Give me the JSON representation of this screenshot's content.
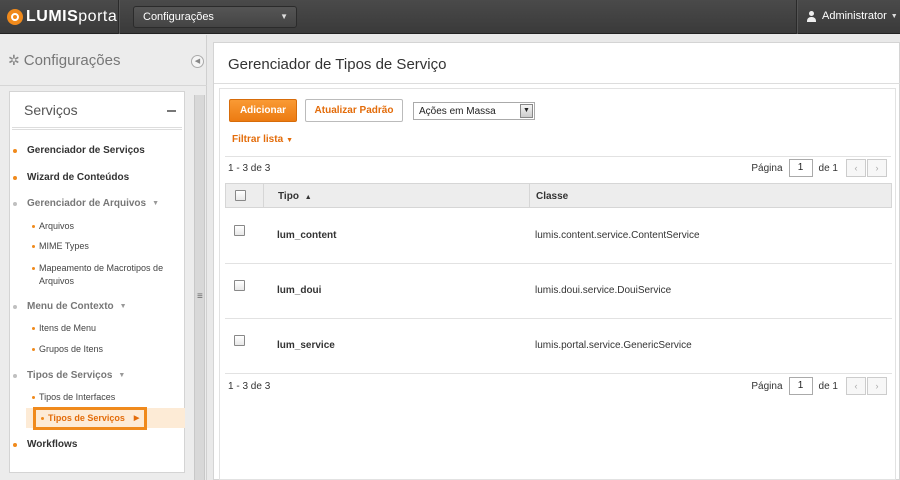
{
  "topbar": {
    "logo_prefix": "LUMIS",
    "logo_suffix": "portal",
    "context_select": "Configurações",
    "user_name": "Administrator"
  },
  "sidebar": {
    "heading": "Configurações",
    "panel_title": "Serviços",
    "items": [
      {
        "label": "Gerenciador de Serviços",
        "type": "item"
      },
      {
        "label": "Wizard de Conteúdos",
        "type": "item"
      },
      {
        "label": "Gerenciador de Arquivos",
        "type": "group",
        "children": [
          "Arquivos",
          "MIME Types",
          "Mapeamento de Macrotipos de Arquivos"
        ]
      },
      {
        "label": "Menu de Contexto",
        "type": "group",
        "children": [
          "Itens de Menu",
          "Grupos de Itens"
        ]
      },
      {
        "label": "Tipos de Serviços",
        "type": "group",
        "children": [
          "Tipos de Interfaces",
          "Tipos de Serviços"
        ]
      },
      {
        "label": "Workflows",
        "type": "item"
      }
    ],
    "active_item": "Tipos de Serviços"
  },
  "main": {
    "title": "Gerenciador de Tipos de Serviço",
    "toolbar": {
      "add_label": "Adicionar",
      "reset_label": "Atualizar Padrão",
      "bulk_actions": "Ações em Massa",
      "filter_label": "Filtrar lista"
    },
    "pagination": {
      "count_text": "1 - 3 de 3",
      "page_label": "Página",
      "page_value": "1",
      "of_text": "de 1"
    },
    "table": {
      "columns": [
        "Tipo",
        "Classe"
      ],
      "sorted_column": "Tipo",
      "rows": [
        {
          "tipo": "lum_content",
          "classe": "lumis.content.service.ContentService"
        },
        {
          "tipo": "lum_doui",
          "classe": "lumis.doui.service.DouiService"
        },
        {
          "tipo": "lum_service",
          "classe": "lumis.portal.service.GenericService"
        }
      ]
    }
  },
  "colors": {
    "accent": "#f08a1c",
    "topbar": "#404040"
  },
  "icons": [
    "logo-icon",
    "user-icon",
    "gear-icon",
    "collapse-icon",
    "splitter-grip-icon",
    "sort-asc-icon"
  ]
}
